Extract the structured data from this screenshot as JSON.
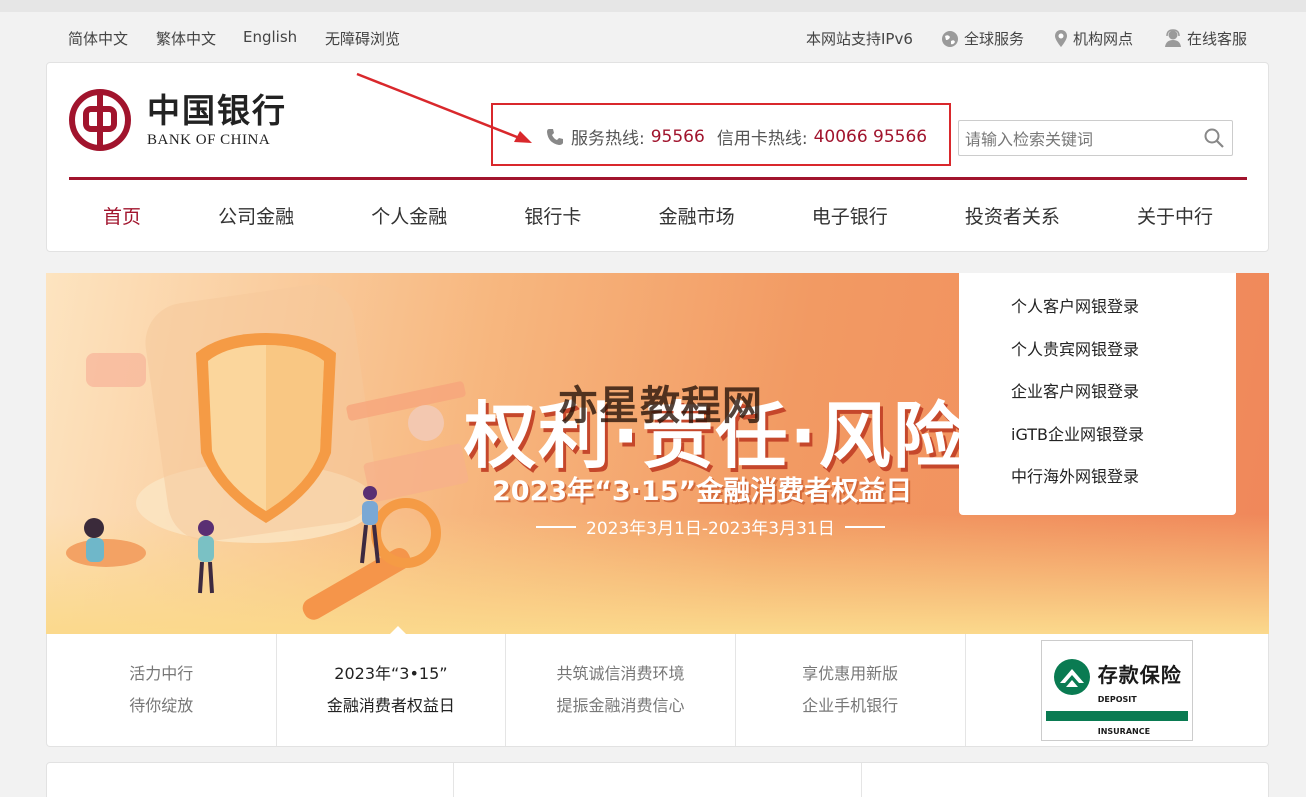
{
  "topbar": {
    "languages": [
      "简体中文",
      "繁体中文",
      "English",
      "无障碍浏览"
    ],
    "ipv6": "本网站支持IPv6",
    "global": "全球服务",
    "branches": "机构网点",
    "online": "在线客服"
  },
  "logo": {
    "cn": "中国银行",
    "en": "BANK OF CHINA"
  },
  "hotline": {
    "service_label": "服务热线:",
    "service_number": "95566",
    "card_label": "信用卡热线:",
    "card_number": "40066 95566"
  },
  "search": {
    "placeholder": "请输入检索关键词"
  },
  "nav": [
    "首页",
    "公司金融",
    "个人金融",
    "银行卡",
    "金融市场",
    "电子银行",
    "投资者关系",
    "关于中行"
  ],
  "banner": {
    "title": "权利·责任·风险",
    "subtitle": "2023年“3·15”金融消费者权益日",
    "date": "2023年3月1日-2023年3月31日",
    "watermark": "亦星教程网"
  },
  "ebank": [
    "个人客户网银登录",
    "个人贵宾网银登录",
    "企业客户网银登录",
    "iGTB企业网银登录",
    "中行海外网银登录"
  ],
  "promo": [
    {
      "line1": "活力中行",
      "line2": "待你绽放"
    },
    {
      "line1": "2023年“3•15”",
      "line2": "金融消费者权益日"
    },
    {
      "line1": "共筑诚信消费环境",
      "line2": "提振金融消费信心"
    },
    {
      "line1": "享优惠用新版",
      "line2": "企业手机银行"
    }
  ],
  "deposit": {
    "title": "存款保险",
    "en": "DEPOSIT INSURANCE"
  },
  "colors": {
    "brand": "#a1142d",
    "annotation": "#d9282c"
  }
}
